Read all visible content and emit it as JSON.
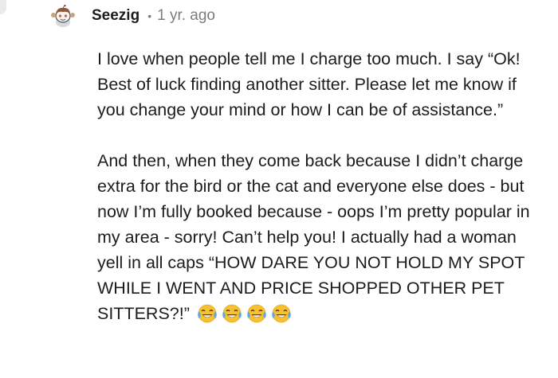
{
  "comment": {
    "username": "Seezig",
    "separator": "•",
    "timestamp": "1 yr. ago",
    "paragraphs": [
      "I love when people tell me I charge too much. I say “Ok! Best of luck finding another sitter. Please let me know if you change your mind or how I can be of assistance.”",
      "And then, when they come back because I didn’t charge extra for the bird or the cat and everyone else does - but now I’m fully booked because - oops I’m pretty popular in my area - sorry! Can’t help you! I actually had a woman yell in all caps “HOW DARE YOU NOT HOLD MY SPOT WHILE I WENT AND PRICE SHOPPED OTHER PET SITTERS?!”"
    ],
    "emojis": [
      "face-with-tears-of-joy",
      "face-with-tears-of-joy",
      "face-with-tears-of-joy",
      "face-with-tears-of-joy"
    ]
  },
  "colors": {
    "text": "#1c1c1c",
    "meta": "#7c7c7c",
    "thread_line": "#e8eaec",
    "emoji_face": "#f7c131",
    "emoji_tears": "#5aa9e6"
  },
  "icons": {
    "avatar": "snoo-avatar-icon"
  }
}
